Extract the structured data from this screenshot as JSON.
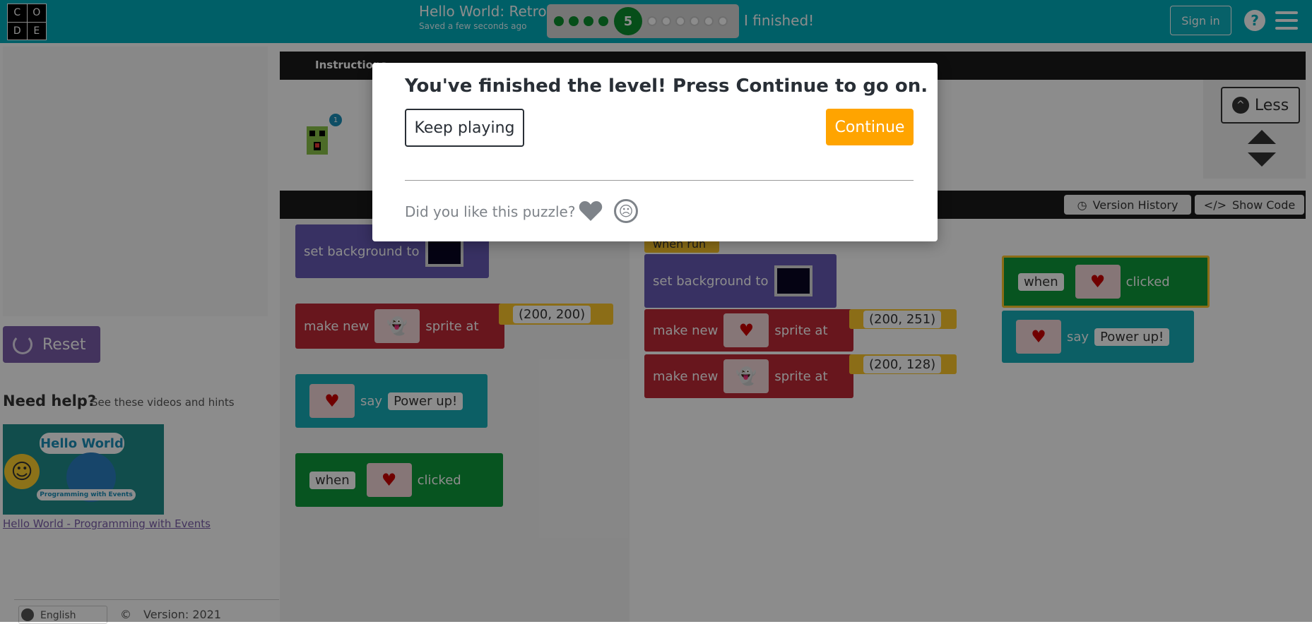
{
  "header": {
    "logo_letters": [
      "C",
      "O",
      "D",
      "E"
    ],
    "level_title": "Hello World: Retro",
    "saved_status": "Saved a few seconds ago",
    "current_level": "5",
    "finished_label": "I finished!",
    "signin_label": "Sign in",
    "help_label": "?"
  },
  "left_panel": {
    "reset_label": "Reset",
    "help_heading": "Need help?",
    "help_sub": "See these videos and hints",
    "video_title": "Hello World",
    "video_subtitle": "Programming with Events",
    "video_link": "Hello World - Programming with Events",
    "language": "English",
    "copyright_icon": "©",
    "version": "Version: 2021"
  },
  "instructions": {
    "tab_label": "Instructions",
    "less_label": "Less"
  },
  "workspace": {
    "version_history_label": "Version History",
    "show_code_label": "Show Code",
    "blocks": {
      "set_background": "set background to",
      "make_new": "make new",
      "sprite_at": "sprite at",
      "say": "say",
      "power_up": "Power up!",
      "when": "when",
      "clicked": "clicked",
      "when_run": "when run",
      "coord_200_200": "(200, 200)",
      "coord_200_251": "(200, 251)",
      "coord_200_128": "(200, 128)"
    }
  },
  "modal": {
    "title": "You've finished the level! Press Continue to go on.",
    "keep_playing_label": "Keep playing",
    "continue_label": "Continue",
    "feedback_label": "Did you like this puzzle?"
  },
  "colors": {
    "header": "#00adbc",
    "continue": "#ffa400",
    "reset": "#7b5daa",
    "progress_done": "#0b8e2f"
  }
}
